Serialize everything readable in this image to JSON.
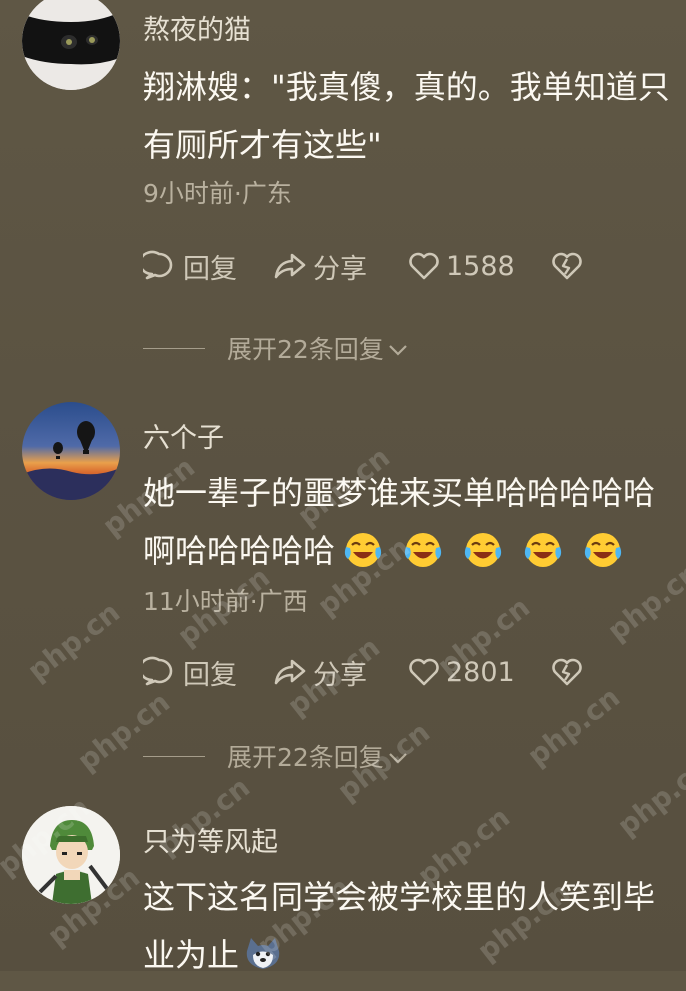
{
  "comments": [
    {
      "username": "熬夜的猫",
      "text": "翔淋嫂：\"我真傻，真的。我单知道只有厕所才有这些\"",
      "meta": "9小时前·广东",
      "reply_label": "回复",
      "share_label": "分享",
      "like_count": "1588",
      "expand_label": "展开22条回复",
      "avatar_icon": "black-cat-avatar"
    },
    {
      "username": "六个子",
      "text": "她一辈子的噩梦谁来买单哈哈哈哈哈啊哈哈哈哈哈",
      "meta": "11小时前·广西",
      "reply_label": "回复",
      "share_label": "分享",
      "like_count": "2801",
      "expand_label": "展开22条回复",
      "avatar_icon": "hot-air-balloon-sunset-avatar",
      "emoji_count": 5,
      "emoji_icon": "crying-laughing-emoji"
    },
    {
      "username": "只为等风起",
      "text": "这下这名同学会被学校里的人笑到毕业为止",
      "avatar_icon": "anime-swordsman-avatar",
      "emoji_icon": "husky-dog-emoji"
    }
  ],
  "watermark_text": "php.cn",
  "colors": {
    "background": "#5b5342",
    "text": "#fbf8f1",
    "meta": "#b9b19f"
  }
}
